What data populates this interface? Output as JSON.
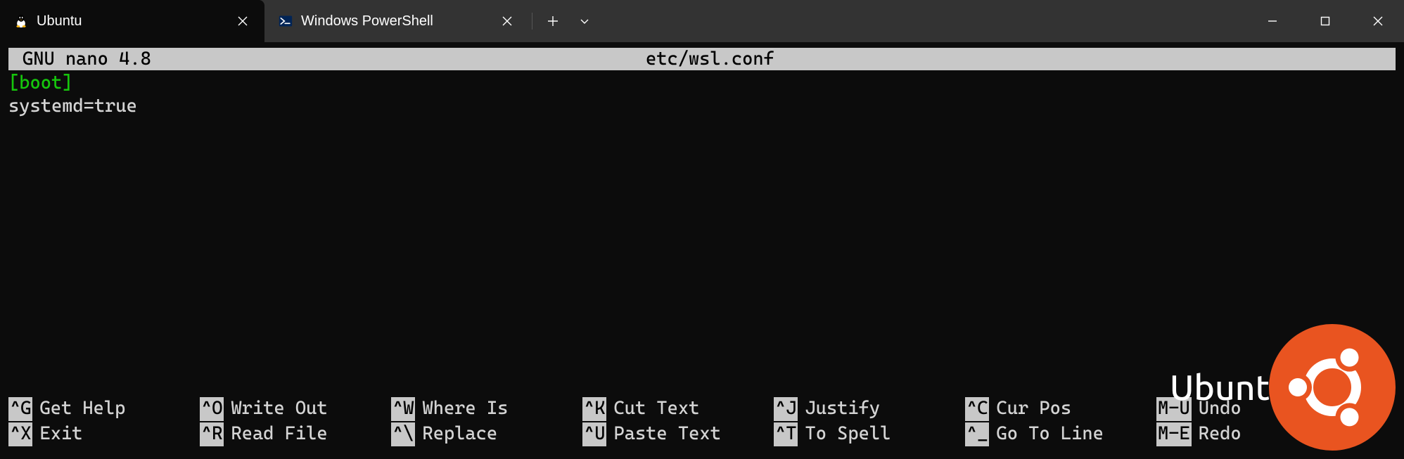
{
  "tabs": {
    "active": {
      "label": "Ubuntu"
    },
    "inactive": {
      "label": "Windows PowerShell"
    }
  },
  "nano": {
    "app": "GNU nano 4.8",
    "filename": "etc/wsl.conf"
  },
  "editor": {
    "line1": "[boot]",
    "line2": "systemd=true"
  },
  "shortcuts": {
    "row1": [
      {
        "key": "^G",
        "desc": "Get Help"
      },
      {
        "key": "^O",
        "desc": "Write Out"
      },
      {
        "key": "^W",
        "desc": "Where Is"
      },
      {
        "key": "^K",
        "desc": "Cut Text"
      },
      {
        "key": "^J",
        "desc": "Justify"
      },
      {
        "key": "^C",
        "desc": "Cur Pos"
      },
      {
        "key": "M-U",
        "desc": "Undo"
      }
    ],
    "row2": [
      {
        "key": "^X",
        "desc": "Exit"
      },
      {
        "key": "^R",
        "desc": "Read File"
      },
      {
        "key": "^\\",
        "desc": "Replace"
      },
      {
        "key": "^U",
        "desc": "Paste Text"
      },
      {
        "key": "^T",
        "desc": "To Spell"
      },
      {
        "key": "^_",
        "desc": "Go To Line"
      },
      {
        "key": "M-E",
        "desc": "Redo"
      }
    ]
  },
  "watermark": {
    "text": "Ubuntu"
  }
}
